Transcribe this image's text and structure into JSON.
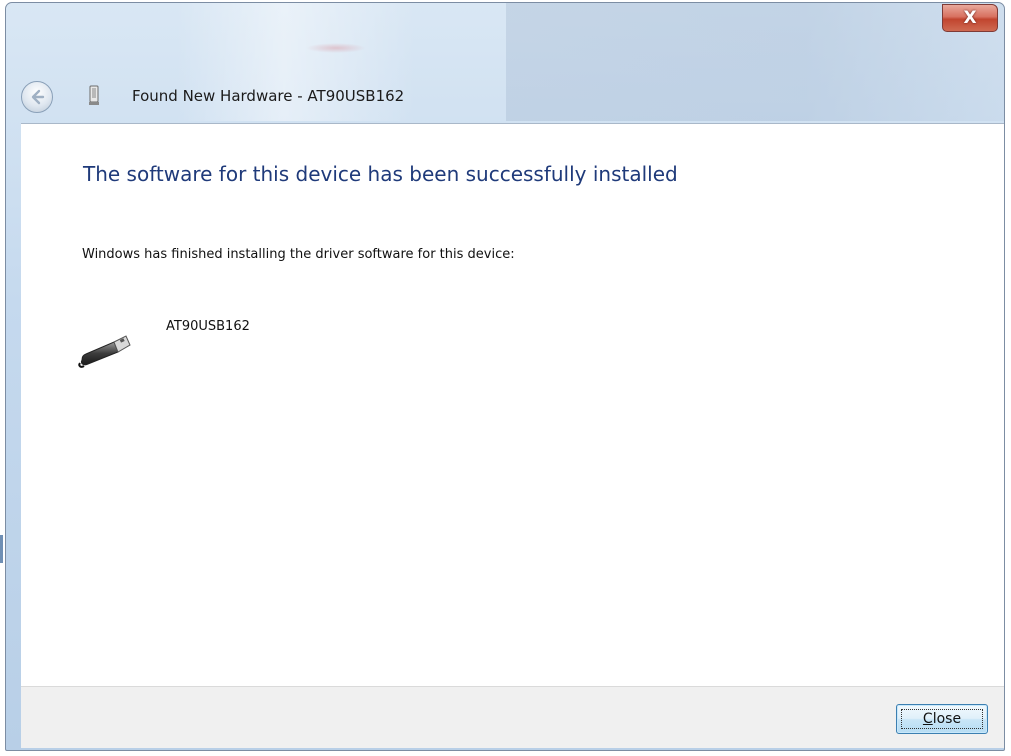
{
  "window": {
    "title": "Found New Hardware - AT90USB162",
    "close_glyph": "X",
    "back_icon": "back-arrow-icon",
    "title_icon": "usb-device-icon"
  },
  "content": {
    "heading": "The software for this device has been successfully installed",
    "description": "Windows has finished installing the driver software for this device:",
    "device": {
      "name": "AT90USB162",
      "icon": "usb-plug-icon"
    }
  },
  "footer": {
    "close_button": {
      "label_mnemonic": "C",
      "label_rest": "lose"
    }
  },
  "colors": {
    "heading": "#1f3a7a",
    "footer_background": "#f0f0f0",
    "window_close": "#c1452f"
  }
}
